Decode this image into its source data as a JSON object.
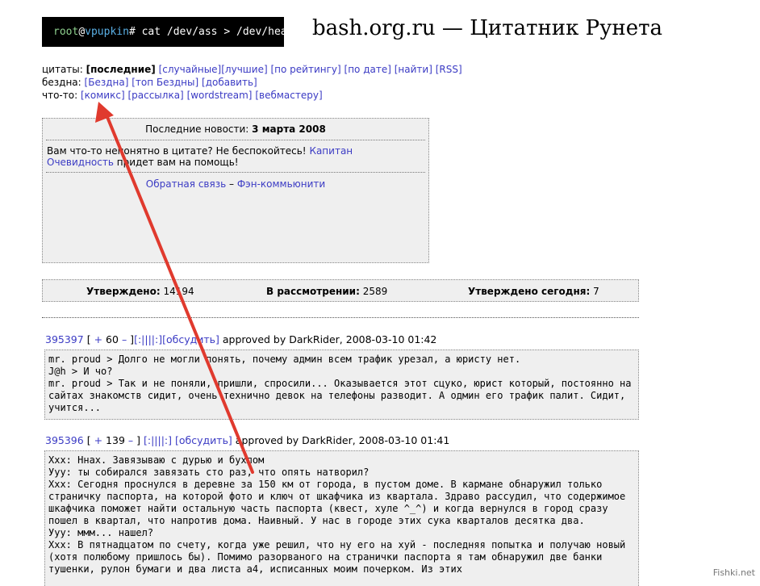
{
  "header": {
    "term_user": "root",
    "term_at": "@",
    "term_host": "vpupkin",
    "term_cmd": "# cat /dev/ass > /dev/head",
    "site_title": "bash.org.ru — Цитатник Рунета"
  },
  "nav": {
    "quotes_label": "цитаты:",
    "quotes_items": [
      "[последние]",
      "[случайные]",
      "[лучшие]",
      "[по рейтингу]",
      "[по дате]",
      "[найти]",
      "[RSS]"
    ],
    "abyss_label": "бездна:",
    "abyss_items": [
      "[Бездна]",
      "[топ Бездны]",
      "[добавить]"
    ],
    "other_label": "что-то:",
    "other_items": [
      "[комикс]",
      "[рассылка]",
      "[wordstream]",
      "[вебмастеру]"
    ]
  },
  "news": {
    "head_prefix": "Последние новости:",
    "head_date": "3 марта 2008",
    "text_before": "Вам что-то непонятно в цитате? Не беспокойтесь! ",
    "text_link": "Капитан Очевидность",
    "text_after": " придет вам на помощь!",
    "link_feedback": "Обратная связь",
    "link_sep": " – ",
    "link_fan": "Фэн-коммьюнити"
  },
  "stats": {
    "approved_label": "Утверждено:",
    "approved_value": "14194",
    "pending_label": "В рассмотрении:",
    "pending_value": "2589",
    "today_label": "Утверждено сегодня:",
    "today_value": "7"
  },
  "quotes": [
    {
      "id": "395397",
      "open": "[",
      "plus": "+",
      "rating": "60",
      "minus": "–",
      "close": "]",
      "bayan": "[:||||:]",
      "discuss": "[обсудить]",
      "meta": "approved by DarkRider, 2008-03-10 01:42",
      "lines": [
        "mr. proud > Долго не могли понять, почему админ всем трафик урезал, а юристу нет.",
        "J@h > И чо?",
        "mr. proud > Так и не поняли, пришли, спросили... Оказывается этот сцуко, юрист который, постоянно на сайтах знакомств сидит, очень технично девок на телефоны разводит. А одмин его трафик палит. Сидит, учится..."
      ]
    },
    {
      "id": "395396",
      "open": "[",
      "plus": "+",
      "rating": "139",
      "minus": "–",
      "close": "]",
      "bayan": "[:||||:]",
      "discuss": "[обсудить]",
      "meta": "approved by DarkRider, 2008-03-10 01:41",
      "lines": [
        "Ххх: Ннах. Завязываю с дурью и бухлом",
        "Ууу: ты собирался завязать сто раз, что опять натворил?",
        "Ххх: Сегодня проснулся в деревне за 150 км от города, в пустом доме. В кармане обнаружил только страничку паспорта, на которой фото и ключ от шкафчика из квартала. Здраво рассудил, что содержимое шкафчика поможет найти остальную часть паспорта (квест, хуле ^_^) и когда вернулся в город сразу пошел в квартал, что напротив дома. Наивный. У нас в городе этих сука кварталов десятка два.",
        "Ууу: ммм... нашел?",
        "Ххх: В пятнадцатом по счету, когда уже решил, что ну его на хуй - последняя попытка и получаю новый (хотя полюбому пришлось бы). Помимо разорваного на странички паспорта я там обнаружил две банки тушенки, рулон бумаги и два листа а4, исписанных моим почерком. Из этих"
      ]
    }
  ],
  "annotation": {
    "arrow_color": "#e03a2e"
  },
  "watermark": "Fishki.net"
}
